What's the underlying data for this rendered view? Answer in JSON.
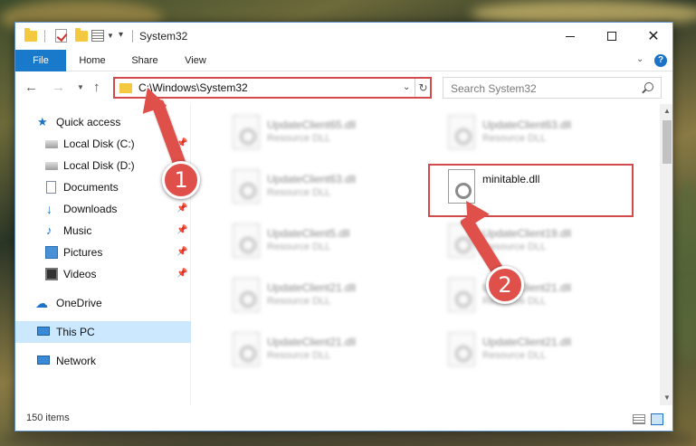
{
  "window": {
    "title": "System32",
    "minimize_glyph": "",
    "maximize_glyph": "",
    "close_glyph": "✕"
  },
  "ribbon": {
    "tabs": [
      "File",
      "Home",
      "Share",
      "View"
    ]
  },
  "navigation": {
    "address": "C:\\Windows\\System32",
    "search_placeholder": "Search System32"
  },
  "sidebar": {
    "items": [
      {
        "label": "Quick access",
        "icon": "star-icon",
        "pinned": false
      },
      {
        "label": "Local Disk (C:)",
        "icon": "drive-icon",
        "pinned": true
      },
      {
        "label": "Local Disk (D:)",
        "icon": "drive-icon",
        "pinned": false
      },
      {
        "label": "Documents",
        "icon": "documents-icon",
        "pinned": true
      },
      {
        "label": "Downloads",
        "icon": "downloads-icon",
        "pinned": true
      },
      {
        "label": "Music",
        "icon": "music-icon",
        "pinned": true
      },
      {
        "label": "Pictures",
        "icon": "pictures-icon",
        "pinned": true
      },
      {
        "label": "Videos",
        "icon": "videos-icon",
        "pinned": true
      },
      {
        "label": "OneDrive",
        "icon": "onedrive-icon",
        "pinned": false
      },
      {
        "label": "This PC",
        "icon": "this-pc-icon",
        "pinned": false,
        "selected": true
      },
      {
        "label": "Network",
        "icon": "network-icon",
        "pinned": false
      }
    ]
  },
  "files": [
    {
      "name": "UpdateClient65.dll",
      "type": "Resource DLL"
    },
    {
      "name": "UpdateClient63.dll",
      "type": "Resource DLL"
    },
    {
      "name": "UpdateClient63.dll",
      "type": "Resource DLL"
    },
    {
      "name": "minitable.dll",
      "type": ""
    },
    {
      "name": "UpdateClient5.dll",
      "type": "Resource DLL"
    },
    {
      "name": "UpdateClient19.dll",
      "type": "Resource DLL"
    },
    {
      "name": "UpdateClient21.dll",
      "type": "Resource DLL"
    },
    {
      "name": "UpdateClient21.dll",
      "type": "Resource DLL"
    },
    {
      "name": "UpdateClient21.dll",
      "type": "Resource DLL"
    },
    {
      "name": "UpdateClient21.dll",
      "type": "Resource DLL"
    }
  ],
  "status": {
    "item_count": "150 items"
  },
  "callouts": {
    "one": "1",
    "two": "2"
  },
  "colors": {
    "accent": "#1979ca",
    "highlight": "#d24a4a",
    "callout": "#e0504b",
    "selection": "#cce8ff"
  }
}
